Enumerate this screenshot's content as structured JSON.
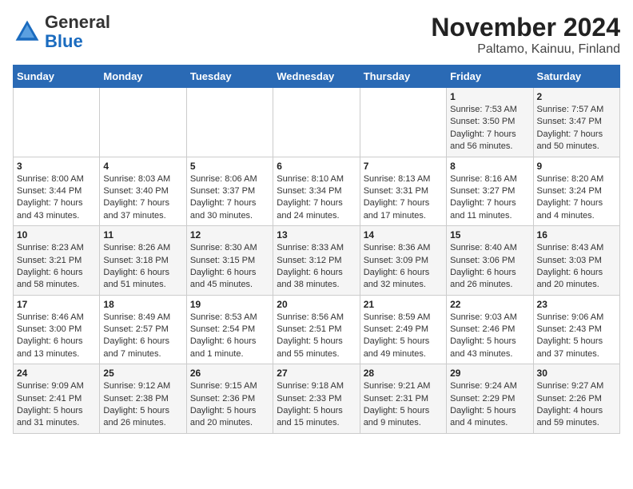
{
  "header": {
    "logo_general": "General",
    "logo_blue": "Blue",
    "month_title": "November 2024",
    "location": "Paltamo, Kainuu, Finland"
  },
  "weekdays": [
    "Sunday",
    "Monday",
    "Tuesday",
    "Wednesday",
    "Thursday",
    "Friday",
    "Saturday"
  ],
  "weeks": [
    [
      {
        "day": "",
        "info": ""
      },
      {
        "day": "",
        "info": ""
      },
      {
        "day": "",
        "info": ""
      },
      {
        "day": "",
        "info": ""
      },
      {
        "day": "",
        "info": ""
      },
      {
        "day": "1",
        "info": "Sunrise: 7:53 AM\nSunset: 3:50 PM\nDaylight: 7 hours\nand 56 minutes."
      },
      {
        "day": "2",
        "info": "Sunrise: 7:57 AM\nSunset: 3:47 PM\nDaylight: 7 hours\nand 50 minutes."
      }
    ],
    [
      {
        "day": "3",
        "info": "Sunrise: 8:00 AM\nSunset: 3:44 PM\nDaylight: 7 hours\nand 43 minutes."
      },
      {
        "day": "4",
        "info": "Sunrise: 8:03 AM\nSunset: 3:40 PM\nDaylight: 7 hours\nand 37 minutes."
      },
      {
        "day": "5",
        "info": "Sunrise: 8:06 AM\nSunset: 3:37 PM\nDaylight: 7 hours\nand 30 minutes."
      },
      {
        "day": "6",
        "info": "Sunrise: 8:10 AM\nSunset: 3:34 PM\nDaylight: 7 hours\nand 24 minutes."
      },
      {
        "day": "7",
        "info": "Sunrise: 8:13 AM\nSunset: 3:31 PM\nDaylight: 7 hours\nand 17 minutes."
      },
      {
        "day": "8",
        "info": "Sunrise: 8:16 AM\nSunset: 3:27 PM\nDaylight: 7 hours\nand 11 minutes."
      },
      {
        "day": "9",
        "info": "Sunrise: 8:20 AM\nSunset: 3:24 PM\nDaylight: 7 hours\nand 4 minutes."
      }
    ],
    [
      {
        "day": "10",
        "info": "Sunrise: 8:23 AM\nSunset: 3:21 PM\nDaylight: 6 hours\nand 58 minutes."
      },
      {
        "day": "11",
        "info": "Sunrise: 8:26 AM\nSunset: 3:18 PM\nDaylight: 6 hours\nand 51 minutes."
      },
      {
        "day": "12",
        "info": "Sunrise: 8:30 AM\nSunset: 3:15 PM\nDaylight: 6 hours\nand 45 minutes."
      },
      {
        "day": "13",
        "info": "Sunrise: 8:33 AM\nSunset: 3:12 PM\nDaylight: 6 hours\nand 38 minutes."
      },
      {
        "day": "14",
        "info": "Sunrise: 8:36 AM\nSunset: 3:09 PM\nDaylight: 6 hours\nand 32 minutes."
      },
      {
        "day": "15",
        "info": "Sunrise: 8:40 AM\nSunset: 3:06 PM\nDaylight: 6 hours\nand 26 minutes."
      },
      {
        "day": "16",
        "info": "Sunrise: 8:43 AM\nSunset: 3:03 PM\nDaylight: 6 hours\nand 20 minutes."
      }
    ],
    [
      {
        "day": "17",
        "info": "Sunrise: 8:46 AM\nSunset: 3:00 PM\nDaylight: 6 hours\nand 13 minutes."
      },
      {
        "day": "18",
        "info": "Sunrise: 8:49 AM\nSunset: 2:57 PM\nDaylight: 6 hours\nand 7 minutes."
      },
      {
        "day": "19",
        "info": "Sunrise: 8:53 AM\nSunset: 2:54 PM\nDaylight: 6 hours\nand 1 minute."
      },
      {
        "day": "20",
        "info": "Sunrise: 8:56 AM\nSunset: 2:51 PM\nDaylight: 5 hours\nand 55 minutes."
      },
      {
        "day": "21",
        "info": "Sunrise: 8:59 AM\nSunset: 2:49 PM\nDaylight: 5 hours\nand 49 minutes."
      },
      {
        "day": "22",
        "info": "Sunrise: 9:03 AM\nSunset: 2:46 PM\nDaylight: 5 hours\nand 43 minutes."
      },
      {
        "day": "23",
        "info": "Sunrise: 9:06 AM\nSunset: 2:43 PM\nDaylight: 5 hours\nand 37 minutes."
      }
    ],
    [
      {
        "day": "24",
        "info": "Sunrise: 9:09 AM\nSunset: 2:41 PM\nDaylight: 5 hours\nand 31 minutes."
      },
      {
        "day": "25",
        "info": "Sunrise: 9:12 AM\nSunset: 2:38 PM\nDaylight: 5 hours\nand 26 minutes."
      },
      {
        "day": "26",
        "info": "Sunrise: 9:15 AM\nSunset: 2:36 PM\nDaylight: 5 hours\nand 20 minutes."
      },
      {
        "day": "27",
        "info": "Sunrise: 9:18 AM\nSunset: 2:33 PM\nDaylight: 5 hours\nand 15 minutes."
      },
      {
        "day": "28",
        "info": "Sunrise: 9:21 AM\nSunset: 2:31 PM\nDaylight: 5 hours\nand 9 minutes."
      },
      {
        "day": "29",
        "info": "Sunrise: 9:24 AM\nSunset: 2:29 PM\nDaylight: 5 hours\nand 4 minutes."
      },
      {
        "day": "30",
        "info": "Sunrise: 9:27 AM\nSunset: 2:26 PM\nDaylight: 4 hours\nand 59 minutes."
      }
    ]
  ]
}
